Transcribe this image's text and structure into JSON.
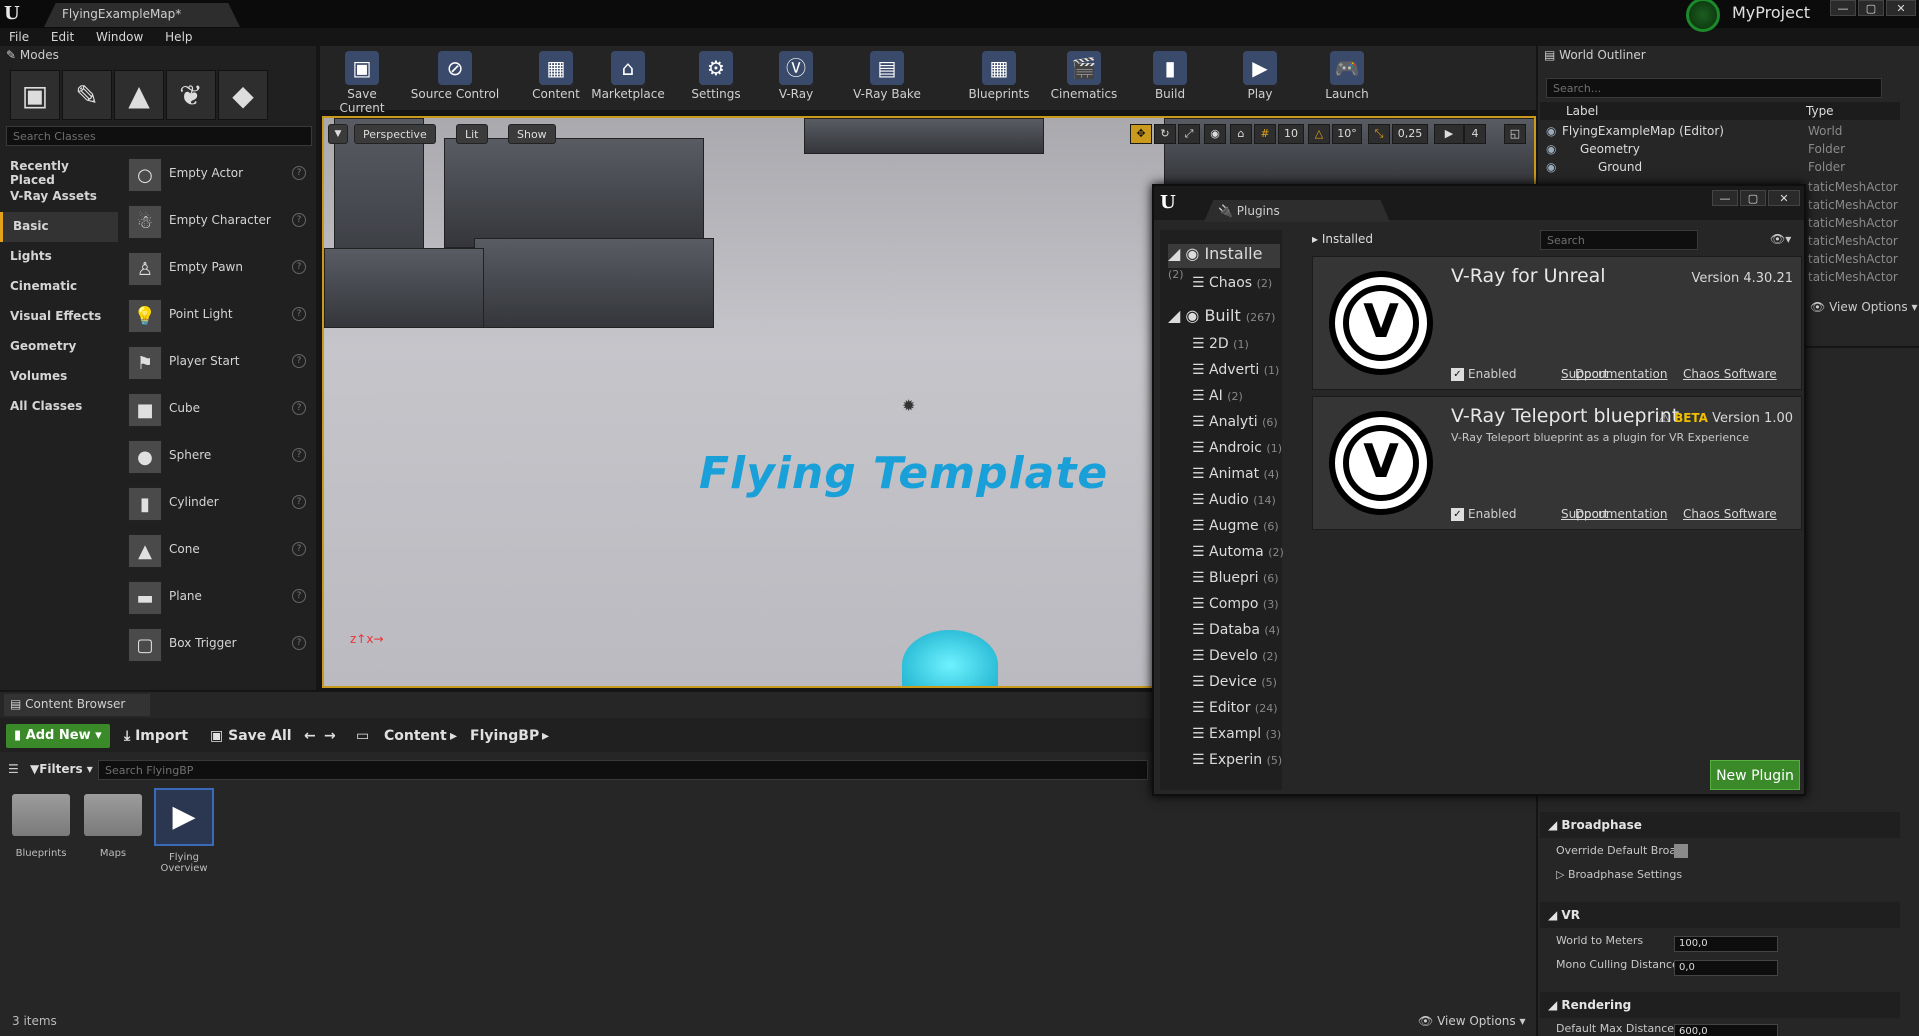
{
  "window": {
    "doc_tab": "FlyingExampleMap*",
    "project_name": "MyProject"
  },
  "menu": [
    "File",
    "Edit",
    "Window",
    "Help"
  ],
  "modes": {
    "tab": "Modes",
    "search_placeholder": "Search Classes",
    "categories": [
      "Recently Placed",
      "V-Ray Assets",
      "Basic",
      "Lights",
      "Cinematic",
      "Visual Effects",
      "Geometry",
      "Volumes",
      "All Classes"
    ],
    "active_category": "Basic",
    "classes": [
      "Empty Actor",
      "Empty Character",
      "Empty Pawn",
      "Point Light",
      "Player Start",
      "Cube",
      "Sphere",
      "Cylinder",
      "Cone",
      "Plane",
      "Box Trigger"
    ]
  },
  "toolbar": [
    "Save Current",
    "Source Control",
    "Content",
    "Marketplace",
    "Settings",
    "V-Ray",
    "V-Ray Bake",
    "Blueprints",
    "Cinematics",
    "Build",
    "Play",
    "Launch"
  ],
  "viewport": {
    "perspective": "Perspective",
    "lit": "Lit",
    "show": "Show",
    "grid_snap": "10",
    "rot_snap": "10°",
    "scale_snap": "0,25",
    "cam_speed": "4",
    "floor_text": "Flying Template"
  },
  "content_browser": {
    "tab": "Content Browser",
    "add_new": "Add New",
    "import": "Import",
    "save_all": "Save All",
    "path": [
      "Content",
      "FlyingBP"
    ],
    "filters": "Filters",
    "search_placeholder": "Search FlyingBP",
    "assets": [
      "Blueprints",
      "Maps",
      "Flying Overview"
    ],
    "count": "3 items",
    "view_options": "View Options"
  },
  "outliner": {
    "tab": "World Outliner",
    "search_placeholder": "Search...",
    "col_label": "Label",
    "col_type": "Type",
    "rows": [
      {
        "label": "FlyingExampleMap (Editor)",
        "type": "World"
      },
      {
        "label": "Geometry",
        "type": "Folder"
      },
      {
        "label": "Ground",
        "type": "Folder"
      }
    ],
    "extra_types": [
      "taticMeshActor",
      "taticMeshActor",
      "taticMeshActor",
      "taticMeshActor",
      "taticMeshActor",
      "taticMeshActor"
    ],
    "view_options": "View Options"
  },
  "details": {
    "sections": [
      "Broadphase",
      "VR",
      "Rendering"
    ],
    "override_label": "Override Default Broac",
    "broadphase_settings": "Broadphase Settings",
    "world_to_meters_label": "World to Meters",
    "world_to_meters": "100,0",
    "mono_culling_label": "Mono Culling Distance",
    "mono_culling": "0,0",
    "default_max_label": "Default Max Distancef",
    "default_max": "600,0"
  },
  "plugins": {
    "tab": "Plugins",
    "installed_header": "Installed",
    "search_placeholder": "Search",
    "categories": [
      {
        "name": "Installe",
        "count": "(2)"
      },
      {
        "name": "Chaos",
        "count": "(2)"
      },
      {
        "name": "Built",
        "count": "(267)"
      },
      {
        "name": "2D",
        "count": "(1)"
      },
      {
        "name": "Adverti",
        "count": "(1)"
      },
      {
        "name": "AI",
        "count": "(2)"
      },
      {
        "name": "Analyti",
        "count": "(6)"
      },
      {
        "name": "Androic",
        "count": "(1)"
      },
      {
        "name": "Animat",
        "count": "(4)"
      },
      {
        "name": "Audio",
        "count": "(14)"
      },
      {
        "name": "Augme",
        "count": "(6)"
      },
      {
        "name": "Automa",
        "count": "(2)"
      },
      {
        "name": "Bluepri",
        "count": "(6)"
      },
      {
        "name": "Compo",
        "count": "(3)"
      },
      {
        "name": "Databa",
        "count": "(4)"
      },
      {
        "name": "Develo",
        "count": "(2)"
      },
      {
        "name": "Device",
        "count": "(5)"
      },
      {
        "name": "Editor",
        "count": "(24)"
      },
      {
        "name": "Exampl",
        "count": "(3)"
      },
      {
        "name": "Experin",
        "count": "(5)"
      }
    ],
    "cards": [
      {
        "name": "V-Ray for Unreal",
        "version": "Version 4.30.21",
        "description": "",
        "beta": ""
      },
      {
        "name": "V-Ray Teleport blueprint",
        "version": "Version 1.00",
        "description": "V-Ray Teleport blueprint as a plugin for VR Experience",
        "beta": "BETA"
      }
    ],
    "enabled": "Enabled",
    "support": "Support",
    "documentation": "Documentation",
    "vendor": "Chaos Software",
    "new_plugin": "New Plugin"
  }
}
